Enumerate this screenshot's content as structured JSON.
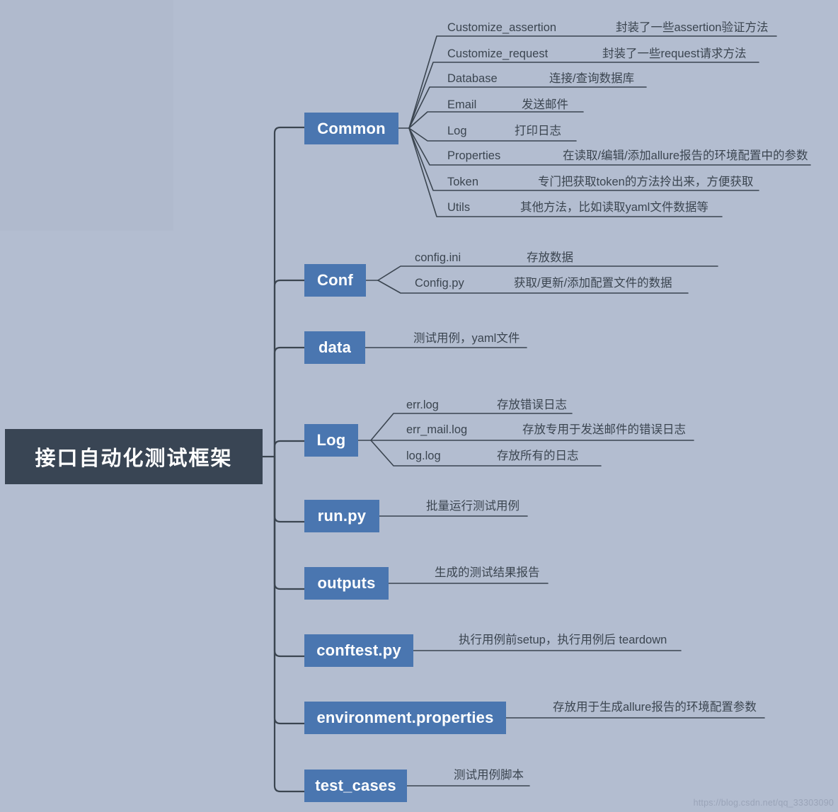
{
  "diagram": {
    "title": "接口自动化测试框架",
    "colors": {
      "background": "#b3bdd0",
      "root_fill": "#394554",
      "node_fill": "#4a76b0",
      "line": "#3b4550",
      "text": "#3b4550",
      "node_text": "#ffffff"
    },
    "branches": [
      {
        "label": "Common",
        "children": [
          {
            "name": "Customize_assertion",
            "desc": "封装了一些assertion验证方法"
          },
          {
            "name": "Customize_request",
            "desc": "封装了一些request请求方法"
          },
          {
            "name": "Database",
            "desc": "连接/查询数据库"
          },
          {
            "name": "Email",
            "desc": "发送邮件"
          },
          {
            "name": "Log",
            "desc": "打印日志"
          },
          {
            "name": "Properties",
            "desc": "在读取/编辑/添加allure报告的环境配置中的参数"
          },
          {
            "name": "Token",
            "desc": "专门把获取token的方法拎出来，方便获取"
          },
          {
            "name": "Utils",
            "desc": "其他方法，比如读取yaml文件数据等"
          }
        ]
      },
      {
        "label": "Conf",
        "children": [
          {
            "name": "config.ini",
            "desc": "存放数据"
          },
          {
            "name": "Config.py",
            "desc": "获取/更新/添加配置文件的数据"
          }
        ]
      },
      {
        "label": "data",
        "children": [],
        "desc": "测试用例，yaml文件"
      },
      {
        "label": "Log",
        "children": [
          {
            "name": "err.log",
            "desc": "存放错误日志"
          },
          {
            "name": "err_mail.log",
            "desc": "存放专用于发送邮件的错误日志"
          },
          {
            "name": "log.log",
            "desc": "存放所有的日志"
          }
        ]
      },
      {
        "label": "run.py",
        "children": [],
        "desc": "批量运行测试用例"
      },
      {
        "label": "outputs",
        "children": [],
        "desc": "生成的测试结果报告"
      },
      {
        "label": "conftest.py",
        "children": [],
        "desc": "执行用例前setup，执行用例后 teardown"
      },
      {
        "label": "environment.properties",
        "children": [],
        "desc": "存放用于生成allure报告的环境配置参数"
      },
      {
        "label": "test_cases",
        "children": [],
        "desc": "测试用例脚本"
      }
    ]
  },
  "watermark": "https://blog.csdn.net/qq_33303090"
}
